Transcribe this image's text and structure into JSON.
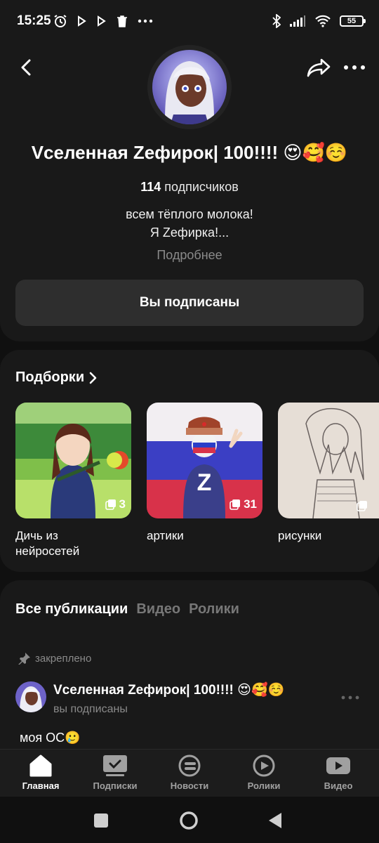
{
  "status_bar": {
    "time": "15:25",
    "battery": "55",
    "icons_left": [
      "alarm-icon",
      "play-icon",
      "play-icon",
      "trash-icon",
      "more-icon"
    ],
    "icons_right": [
      "bluetooth-icon",
      "signal-icon",
      "wifi-icon",
      "battery-icon"
    ]
  },
  "header": {
    "back_icon": "back-arrow-icon",
    "share_icon": "share-icon",
    "more_icon": "more-dots-icon"
  },
  "channel": {
    "title": "Vселенная Zефирок| 100!!!! 😍🥰☺️",
    "subscribers_count": "114",
    "subscribers_label": " подписчиков",
    "description_line1": "всем тёплого молока!",
    "description_line2": "Я Zефирка!...",
    "more_link": "Подробнее",
    "subscribe_button": "Вы подписаны"
  },
  "collections": {
    "title": "Подборки",
    "items": [
      {
        "label": "Дичь из нейросетей",
        "count": "3"
      },
      {
        "label": "артики",
        "count": "31"
      },
      {
        "label": "рисунки",
        "count": ""
      }
    ]
  },
  "publications": {
    "tabs": [
      "Все публикации",
      "Видео",
      "Ролики"
    ],
    "pinned_label": "закреплено",
    "post": {
      "author": "Vселенная Zефирок| 100!!!! 😍🥰☺️",
      "subtitle": "вы подписаны",
      "text": "моя ОС🥲"
    }
  },
  "bottom_nav": {
    "items": [
      {
        "label": "Главная",
        "icon": "home-icon",
        "active": true
      },
      {
        "label": "Подписки",
        "icon": "subscriptions-icon",
        "active": false
      },
      {
        "label": "Новости",
        "icon": "news-icon",
        "active": false
      },
      {
        "label": "Ролики",
        "icon": "shorts-icon",
        "active": false
      },
      {
        "label": "Видео",
        "icon": "video-icon",
        "active": false
      }
    ]
  },
  "system_nav": [
    "square-icon",
    "circle-icon",
    "triangle-back-icon"
  ]
}
